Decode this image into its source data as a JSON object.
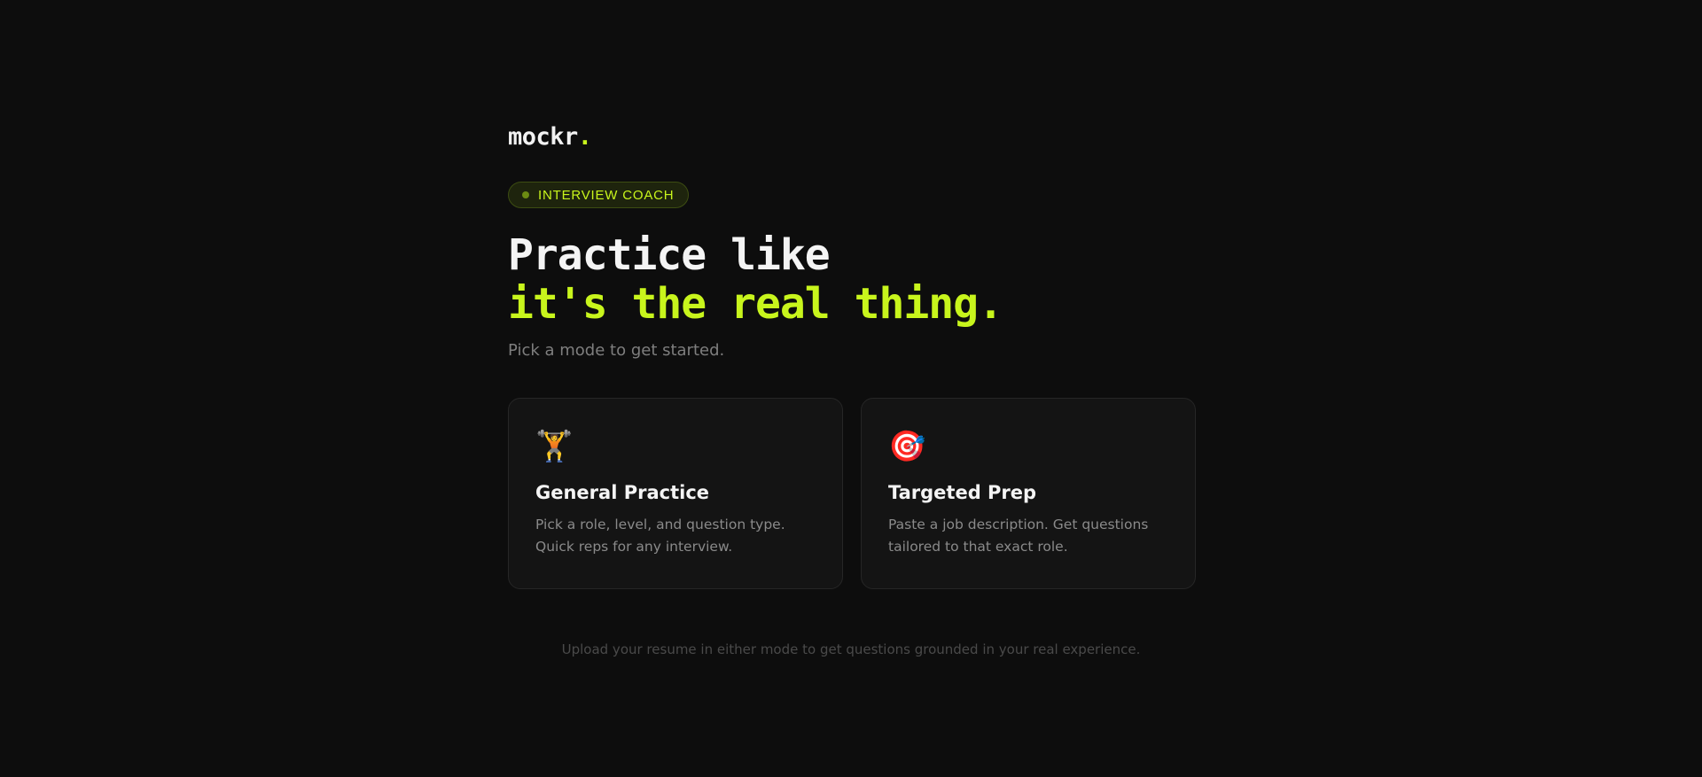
{
  "brand": {
    "name": "mockr",
    "dot": ".",
    "accent_color": "#c8f51c"
  },
  "badge": {
    "label": "INTERVIEW COACH"
  },
  "hero": {
    "line1": "Practice like",
    "line2": "it's the real thing.",
    "subtitle": "Pick a mode to get started."
  },
  "modes": [
    {
      "icon": "weightlifter-icon",
      "glyph": "🏋️",
      "title": "General Practice",
      "description": "Pick a role, level, and question type. Quick reps for any interview."
    },
    {
      "icon": "target-icon",
      "glyph": "🎯",
      "title": "Targeted Prep",
      "description": "Paste a job description. Get questions tailored to that exact role."
    }
  ],
  "footnote": "Upload your resume in either mode to get questions grounded in your real experience."
}
